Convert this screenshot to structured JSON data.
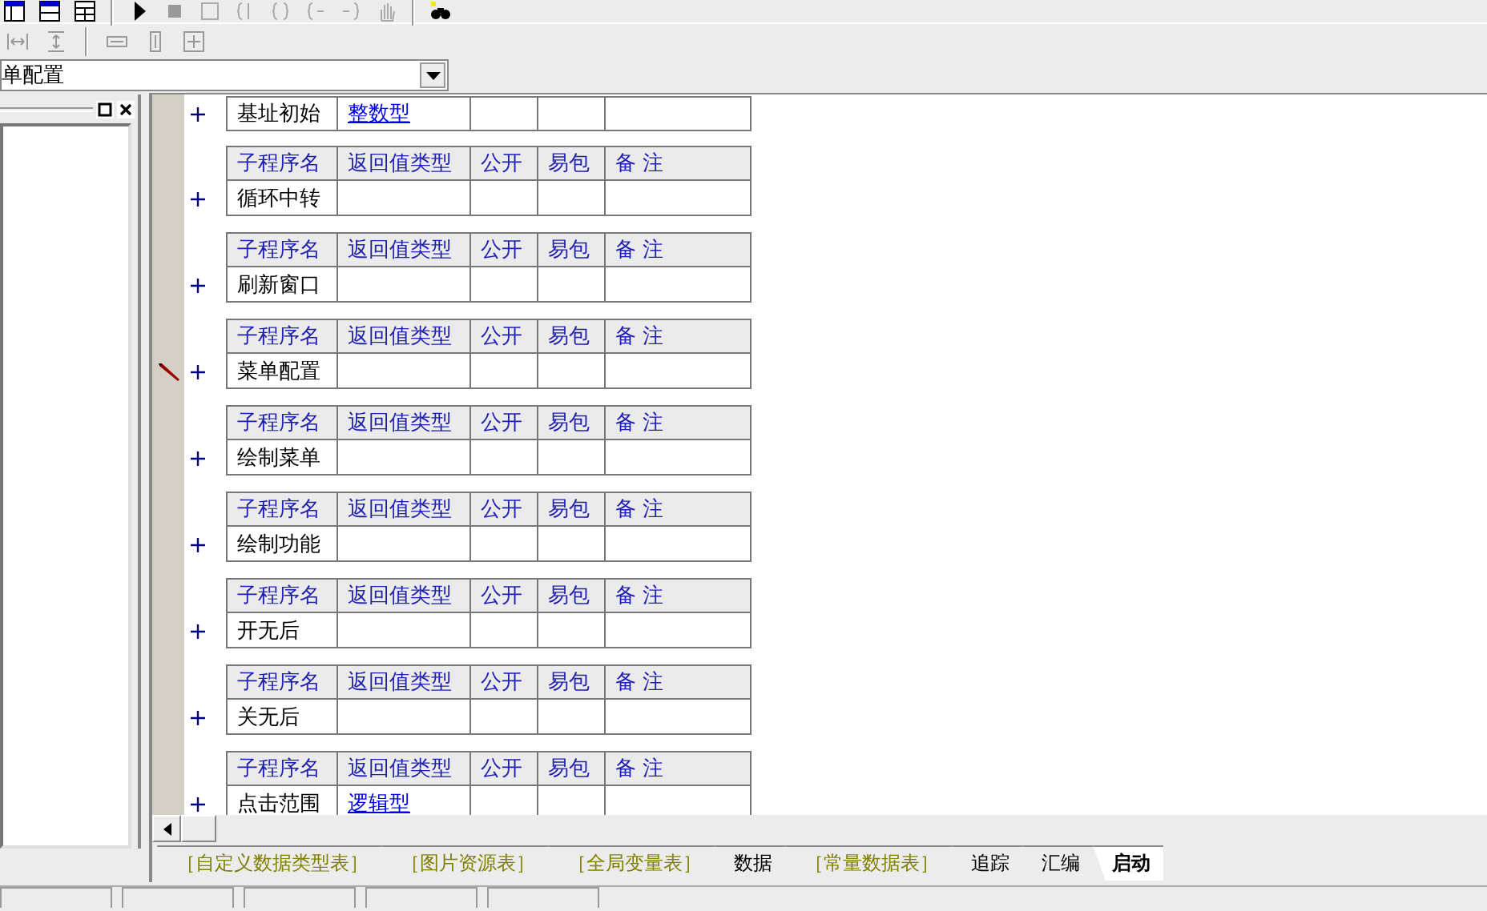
{
  "combo": {
    "value": "单配置"
  },
  "subroutines": [
    {
      "name": "基址初始",
      "return_type": "整数型",
      "current": false
    },
    {
      "columns": [
        "子程序名",
        "返回值类型",
        "公开",
        "易包",
        "备 注"
      ],
      "name": "循环中转",
      "current": false
    },
    {
      "columns": [
        "子程序名",
        "返回值类型",
        "公开",
        "易包",
        "备 注"
      ],
      "name": "刷新窗口",
      "current": false
    },
    {
      "columns": [
        "子程序名",
        "返回值类型",
        "公开",
        "易包",
        "备 注"
      ],
      "name": "菜单配置",
      "current": true
    },
    {
      "columns": [
        "子程序名",
        "返回值类型",
        "公开",
        "易包",
        "备 注"
      ],
      "name": "绘制菜单",
      "current": false
    },
    {
      "columns": [
        "子程序名",
        "返回值类型",
        "公开",
        "易包",
        "备 注"
      ],
      "name": "绘制功能",
      "current": false
    },
    {
      "columns": [
        "子程序名",
        "返回值类型",
        "公开",
        "易包",
        "备 注"
      ],
      "name": "开无后",
      "current": false
    },
    {
      "columns": [
        "子程序名",
        "返回值类型",
        "公开",
        "易包",
        "备 注"
      ],
      "name": "关无后",
      "current": false
    },
    {
      "columns": [
        "子程序名",
        "返回值类型",
        "公开",
        "易包",
        "备 注"
      ],
      "name": "点击范围",
      "return_type": "逻辑型",
      "current": false
    }
  ],
  "tabs": [
    {
      "label": "［自定义数据类型表］",
      "kind": "table",
      "selected": false
    },
    {
      "label": "［图片资源表］",
      "kind": "table",
      "selected": false
    },
    {
      "label": "［全局变量表］",
      "kind": "table",
      "selected": false
    },
    {
      "label": "数据",
      "kind": "module",
      "selected": false
    },
    {
      "label": "［常量数据表］",
      "kind": "table",
      "selected": false
    },
    {
      "label": "追踪",
      "kind": "module",
      "selected": false
    },
    {
      "label": "汇编",
      "kind": "module",
      "selected": false
    },
    {
      "label": "启动",
      "kind": "module",
      "selected": true
    }
  ]
}
